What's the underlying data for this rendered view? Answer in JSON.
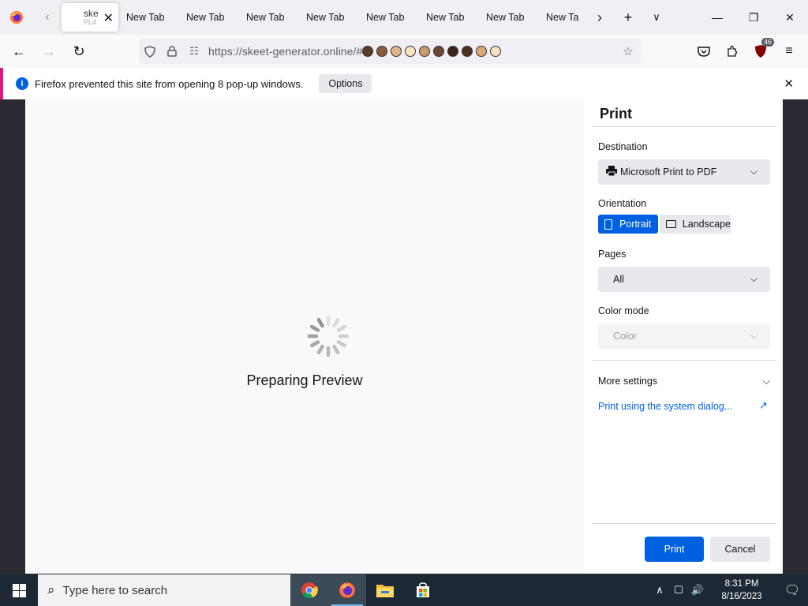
{
  "browser": {
    "active_tab": {
      "title": "ske",
      "subtitle": "PL4"
    },
    "tabs": [
      "New Tab",
      "New Tab",
      "New Tab",
      "New Tab",
      "New Tab",
      "New Tab",
      "New Tab",
      "New Ta"
    ],
    "url": "https://skeet-generator.online/#",
    "extension_badge": "46"
  },
  "notification": {
    "text": "Firefox prevented this site from opening 8 pop-up windows.",
    "options_label": "Options"
  },
  "preview": {
    "status": "Preparing Preview"
  },
  "print_panel": {
    "title": "Print",
    "destination_label": "Destination",
    "destination_value": "Microsoft Print to PDF",
    "orientation_label": "Orientation",
    "portrait_label": "Portrait",
    "landscape_label": "Landscape",
    "pages_label": "Pages",
    "pages_value": "All",
    "color_mode_label": "Color mode",
    "color_mode_value": "Color",
    "more_settings_label": "More settings",
    "system_dialog_link": "Print using the system dialog...",
    "print_button": "Print",
    "cancel_button": "Cancel"
  },
  "taskbar": {
    "search_placeholder": "Type here to search",
    "time": "8:31 PM",
    "date": "8/16/2023"
  },
  "colors": {
    "accent": "#0061e0",
    "notification_stripe": "#e31587",
    "taskbar": "#1c2833"
  }
}
